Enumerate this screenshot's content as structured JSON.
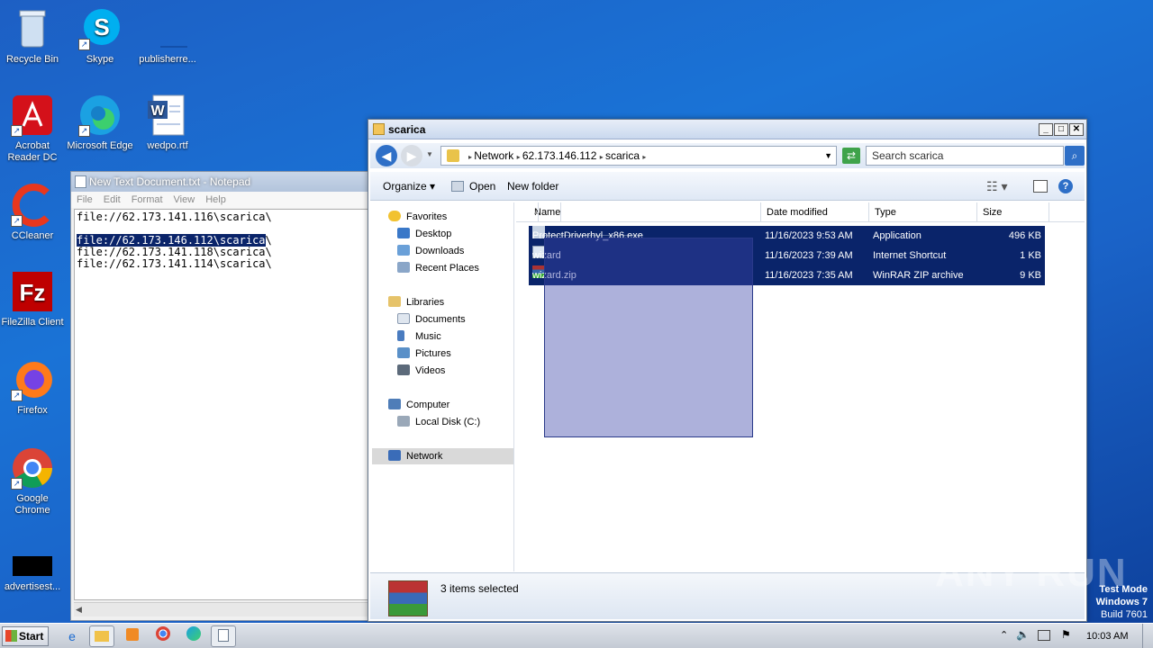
{
  "desktop": {
    "icons": [
      "Recycle Bin",
      "Skype",
      "publisherre...",
      "Acrobat Reader DC",
      "Microsoft Edge",
      "wedpo.rtf",
      "CCleaner",
      "FileZilla Client",
      "Firefox",
      "Google Chrome",
      "advertisest..."
    ]
  },
  "notepad": {
    "title": "New Text Document.txt - Notepad",
    "menu": [
      "File",
      "Edit",
      "Format",
      "View",
      "Help"
    ],
    "lines": [
      "file://62.173.141.116\\scarica\\",
      "",
      "file://62.173.146.112\\scarica",
      "\\",
      "file://62.173.141.118\\scarica\\",
      "file://62.173.141.114\\scarica\\"
    ]
  },
  "explorer": {
    "title": "scarica",
    "breadcrumb": [
      "Network",
      "62.173.146.112",
      "scarica"
    ],
    "search_placeholder": "Search scarica",
    "toolbar": {
      "organize": "Organize",
      "open": "Open",
      "new_folder": "New folder"
    },
    "nav": {
      "favorites": "Favorites",
      "desktop": "Desktop",
      "downloads": "Downloads",
      "recent": "Recent Places",
      "libraries": "Libraries",
      "documents": "Documents",
      "music": "Music",
      "pictures": "Pictures",
      "videos": "Videos",
      "computer": "Computer",
      "local_disk": "Local Disk (C:)",
      "network": "Network"
    },
    "columns": {
      "name": "Name",
      "date": "Date modified",
      "type": "Type",
      "size": "Size"
    },
    "files": [
      {
        "name": "ProtectDriverhyl_x86.exe",
        "date": "11/16/2023 9:53 AM",
        "type": "Application",
        "size": "496 KB"
      },
      {
        "name": "wizard",
        "date": "11/16/2023 7:39 AM",
        "type": "Internet Shortcut",
        "size": "1 KB"
      },
      {
        "name": "wizard.zip",
        "date": "11/16/2023 7:35 AM",
        "type": "WinRAR ZIP archive",
        "size": "9 KB"
      }
    ],
    "status": "3 items selected"
  },
  "taskbar": {
    "start": "Start",
    "clock": "10:03 AM"
  },
  "watermark": {
    "brand": "ANY RUN",
    "line1": "Test Mode",
    "line2": "Windows 7",
    "line3": "Build 7601"
  }
}
